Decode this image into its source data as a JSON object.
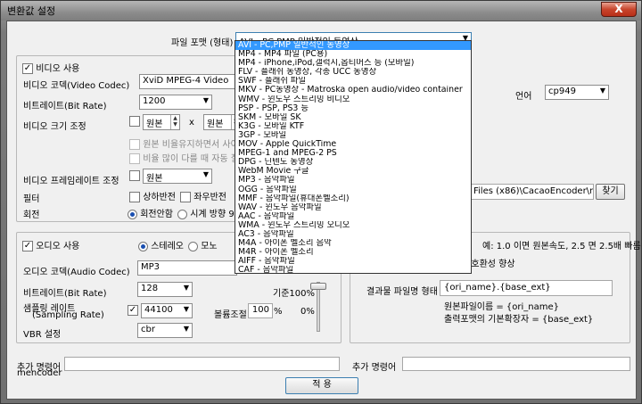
{
  "window": {
    "title": "변환값 설정",
    "close_label": "X"
  },
  "format": {
    "label": "파일 포맷 (형태)",
    "selected": "AVI - PC,PMP 일반적인 동영상",
    "options": [
      "AVI - PC,PMP 일반적인 동영상",
      "MP4 - MP4 파일 (PC용)",
      "MP4 - iPhone,iPod,갤럭시,옵티머스 등 (모바일)",
      "FLV - 플래쉬 동영상, 각종 UCC 동영상",
      "SWF - 플래쉬 파일",
      "MKV - PC동영상 - Matroska open audio/video container",
      "WMV - 윈도우 스트리밍 비디오",
      "PSP - PSP, PS3 등",
      "SKM - 모바일 SK",
      "K3G - 모바일 KTF",
      "3GP - 모바일",
      "MOV - Apple QuickTime",
      "MPEG-1 and MPEG-2 PS",
      "DPG - 닌텐도 동영상",
      "WebM Movie 구글",
      "MP3 - 음악파일",
      "OGG - 음악파일",
      "MMF - 음악파일(휴대폰벨소리)",
      "WAV - 윈도우 음악파일",
      "AAC - 음악파일",
      "WMA - 윈도우 스트리밍 오디오",
      "AC3 - 음악파일",
      "M4A - 아이폰 벨소리 음악",
      "M4R - 아이폰 벨소리",
      "AIFF - 음악파일",
      "CAF - 음악파일",
      "FLAC - 무손실 음악코덱",
      "ASF - ASF 동영상",
      "기타 - 사용자정의"
    ]
  },
  "video": {
    "enable_label": "비디오 사용",
    "enabled": "✓",
    "codec_label": "비디오 코덱(Video Codec)",
    "codec_value": "XviD MPEG-4 Video",
    "bitrate_label": "비트레이트(Bit Rate)",
    "bitrate_value": "1200",
    "size_label": "비디오 크기 조정",
    "width_value": "원본",
    "x_label": "x",
    "height_value": "원본",
    "keep_ratio_label": "원본 비율유지하면서 사이즈",
    "ratio_diff_label": "비율 많이 다를 때 자동 잘라",
    "framerate_label": "비디오 프레임레이트 조정",
    "framerate_value": "원본",
    "filter_label": "필터",
    "flip_v_label": "상하반전",
    "flip_h_label": "좌우반전",
    "rotate_label": "회전",
    "rotate_none_label": "회전안함",
    "rotate_cw_label": "시계 방향 90"
  },
  "language": {
    "label": "언어",
    "value": "cp949"
  },
  "encoder_path": {
    "value": "Files (x86)\\CacaoEncoder\\mr",
    "button": "찾기"
  },
  "audio": {
    "enable_label": "오디오 사용",
    "enabled": "✓",
    "stereo_label": "스테레오",
    "mono_label": "모노",
    "codec_label": "오디오 코덱(Audio Codec)",
    "codec_value": "MP3",
    "bitrate_label": "비트레이트(Bit Rate)",
    "bitrate_value": "128",
    "samplerate_label_1": "샘플링 레이트",
    "samplerate_label_2": "(Sampling Rate)",
    "samplerate_enabled": "✓",
    "samplerate_value": "44100",
    "volume_label": "볼륨조절",
    "volume_value": "100",
    "percent": "%",
    "vbr_label": "VBR 설정",
    "vbr_value": "cbr",
    "speed_top": "기준100%",
    "speed_bottom": "0%"
  },
  "speed": {
    "hint": "예: 1.0 이면 원본속도, 2.5 면 2.5배 빠름",
    "pitch_hint": "/호환성 향상"
  },
  "output": {
    "label": "결과물 파일명 형태",
    "value": "{ori_name}.{base_ext}",
    "note_1": "원본파일이름 = {ori_name}",
    "note_2": "출력포맷의 기본확장자 = {base_ext}"
  },
  "extra": {
    "left_label_1": "추가 명령어",
    "left_label_2": "mencoder",
    "left_value": "",
    "right_label": "추가 명령어",
    "right_value": ""
  },
  "apply_button": "적 용"
}
